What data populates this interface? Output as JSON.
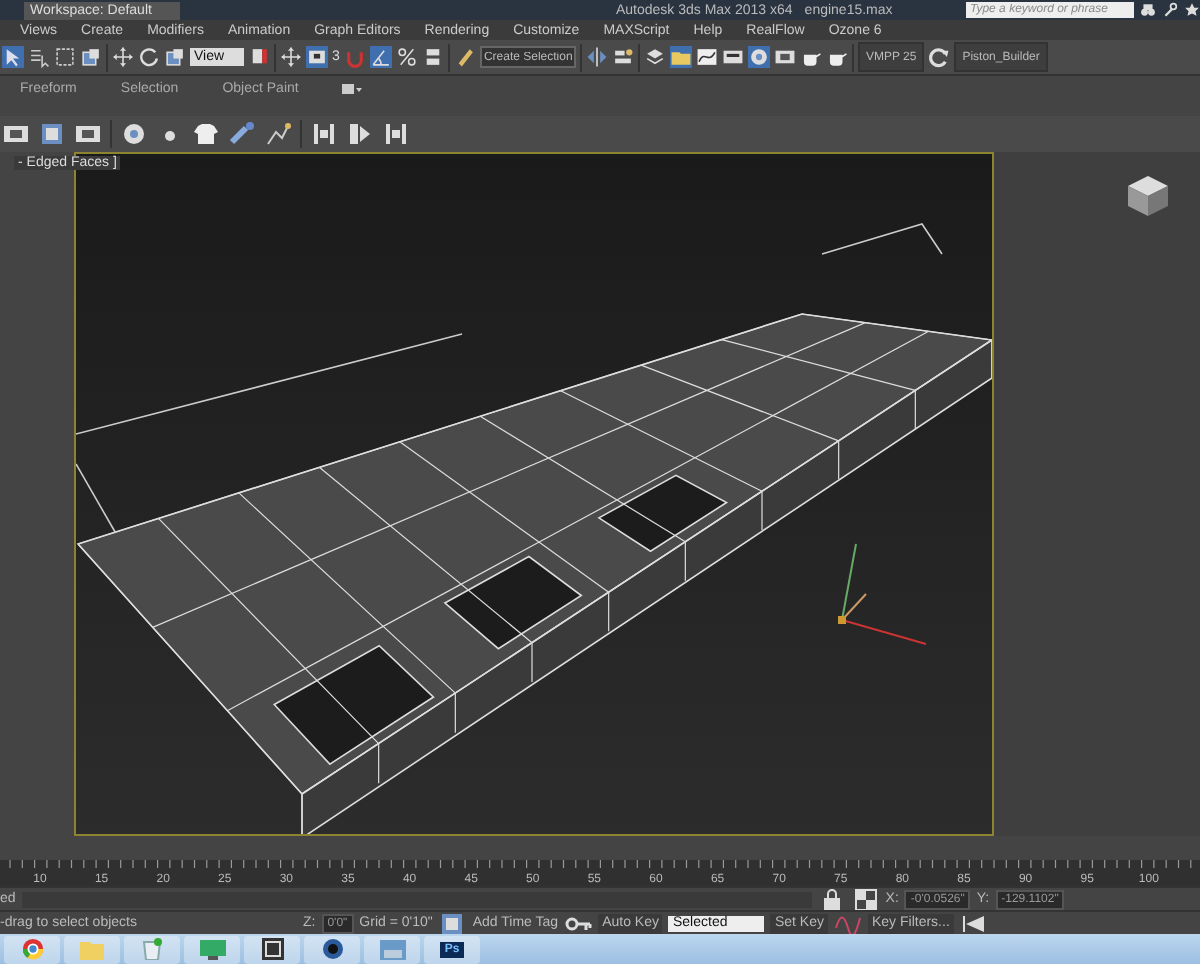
{
  "title_bar": {
    "workspace": "Workspace: Default",
    "title": "Autodesk 3ds Max 2013 x64",
    "file": "engine15.max",
    "search": {
      "placeholder": "Type a keyword or phrase"
    }
  },
  "menu": [
    "Views",
    "Create",
    "Modifiers",
    "Animation",
    "Graph Editors",
    "Rendering",
    "Customize",
    "MAXScript",
    "Help",
    "RealFlow",
    "Ozone 6"
  ],
  "main_toolbar": {
    "reference_dropdown": "View",
    "snap_label": "3",
    "selection_set_field": {
      "placeholder": "Create Selection"
    },
    "buttons": [
      "VMPP 25",
      "Piston_Builder"
    ]
  },
  "ribbon_tabs": [
    "Freeform",
    "Selection",
    "Object Paint"
  ],
  "viewport": {
    "label": "- Edged Faces ]"
  },
  "timeline": {
    "ticks": [
      "10",
      "15",
      "20",
      "25",
      "30",
      "35",
      "40",
      "45",
      "50",
      "55",
      "60",
      "65",
      "70",
      "75",
      "80",
      "85",
      "90",
      "95",
      "100"
    ]
  },
  "status": {
    "x_label": "X:",
    "y_label": "Y:",
    "z_label": "Z:",
    "selection": "ed",
    "prompt": "-drag to select objects",
    "x": "-0'0.0526\"",
    "y": "-129.1102\"",
    "z": "0'0\"",
    "grid": "Grid = 0'10\"",
    "add_time_tag": "Add Time Tag",
    "auto_key": "Auto Key",
    "key_mode": "Selected",
    "set_key": "Set Key",
    "key_filters": "Key Filters..."
  },
  "taskbar": [
    {
      "kind": "browser"
    },
    {
      "kind": "folder"
    },
    {
      "kind": "recycle"
    },
    {
      "kind": "monitor"
    },
    {
      "kind": "max"
    },
    {
      "kind": "media"
    },
    {
      "kind": "viewer"
    },
    {
      "kind": "photoshop",
      "label": "Ps"
    }
  ]
}
